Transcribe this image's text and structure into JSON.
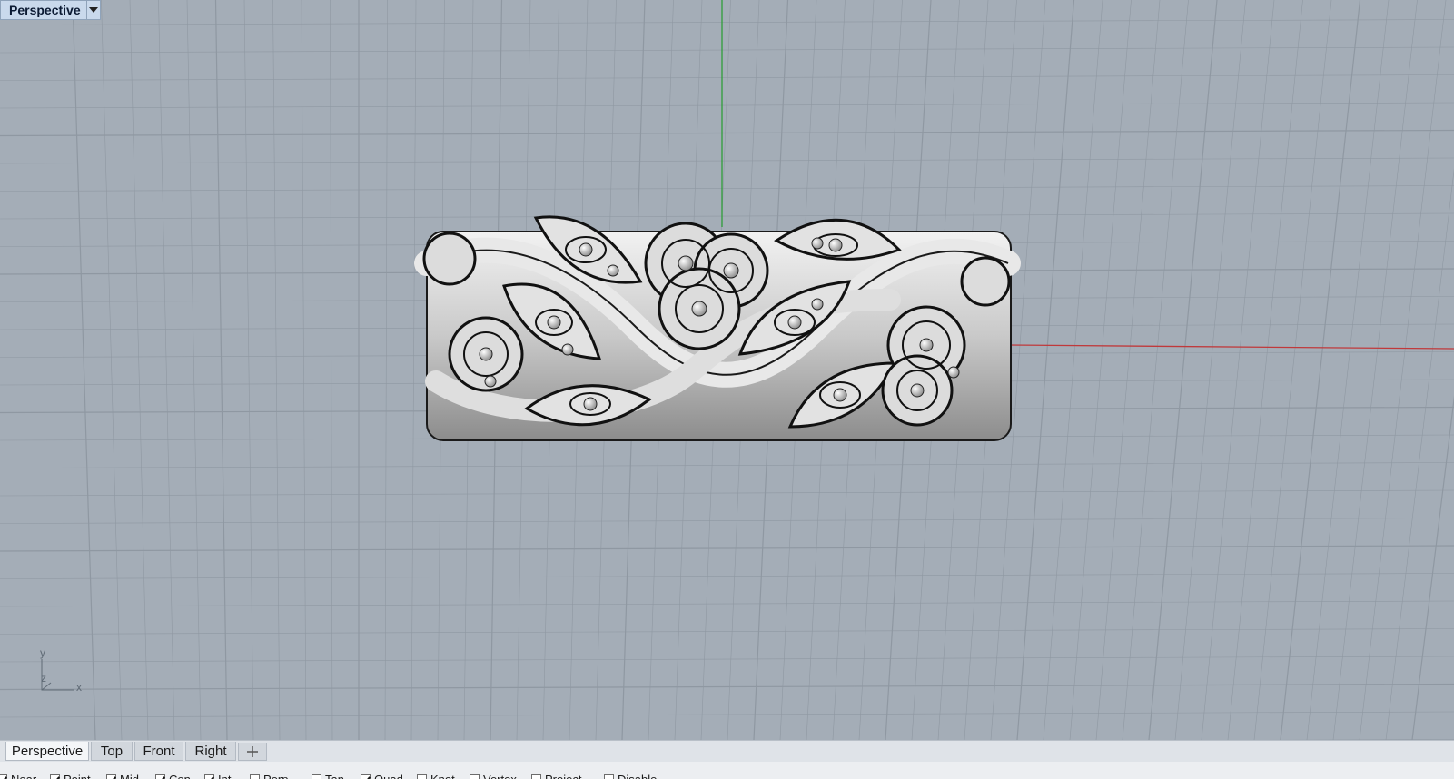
{
  "viewport": {
    "title": "Perspective",
    "background": "#a4adb7",
    "grid_color": "#8f98a2",
    "x_axis_color": "#c0393b",
    "y_axis_color": "#2f9e3a",
    "model_icon": "ornate-floral-ring-model",
    "axis_icon": {
      "y": "y",
      "z": "z",
      "x": "x"
    }
  },
  "tabs": [
    {
      "label": "Perspective",
      "active": true
    },
    {
      "label": "Top",
      "active": false
    },
    {
      "label": "Front",
      "active": false
    },
    {
      "label": "Right",
      "active": false
    }
  ],
  "add_tab_icon": "plus-icon",
  "osnaps": [
    {
      "label": "Near",
      "checked": true
    },
    {
      "label": "Point",
      "checked": true
    },
    {
      "label": "Mid",
      "checked": true
    },
    {
      "label": "Cen",
      "checked": true
    },
    {
      "label": "Int",
      "checked": true
    },
    {
      "label": "Perp",
      "checked": false
    },
    {
      "label": "Tan",
      "checked": false
    },
    {
      "label": "Quad",
      "checked": true
    },
    {
      "label": "Knot",
      "checked": false
    },
    {
      "label": "Vertex",
      "checked": false
    },
    {
      "label": "Project",
      "checked": false
    },
    {
      "label": "Disable",
      "checked": false
    }
  ]
}
